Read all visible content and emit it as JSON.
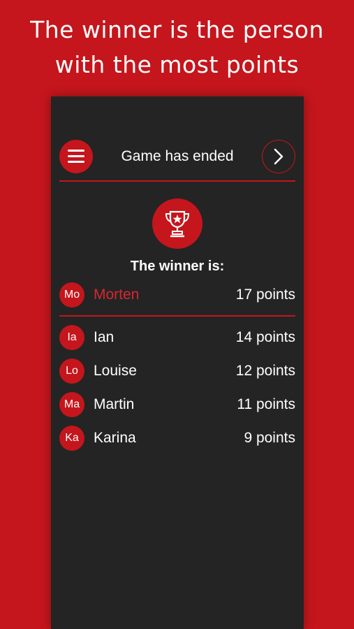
{
  "promo": {
    "line1": "The winner is the person",
    "line2": "with the most points"
  },
  "header": {
    "title": "Game has ended",
    "menu_icon": "hamburger-menu-icon",
    "next_icon": "chevron-right-icon"
  },
  "trophy_icon": "trophy-star-icon",
  "winner_label": "The winner is:",
  "winner": {
    "initials": "Mo",
    "name": "Morten",
    "points": "17 points"
  },
  "others": [
    {
      "initials": "Ia",
      "name": "Ian",
      "points": "14 points"
    },
    {
      "initials": "Lo",
      "name": "Louise",
      "points": "12 points"
    },
    {
      "initials": "Ma",
      "name": "Martin",
      "points": "11 points"
    },
    {
      "initials": "Ka",
      "name": "Karina",
      "points": "9 points"
    }
  ],
  "colors": {
    "accent": "#c4161c",
    "panel": "#242424",
    "text": "#ffffff",
    "winner_name": "#d7282f"
  }
}
